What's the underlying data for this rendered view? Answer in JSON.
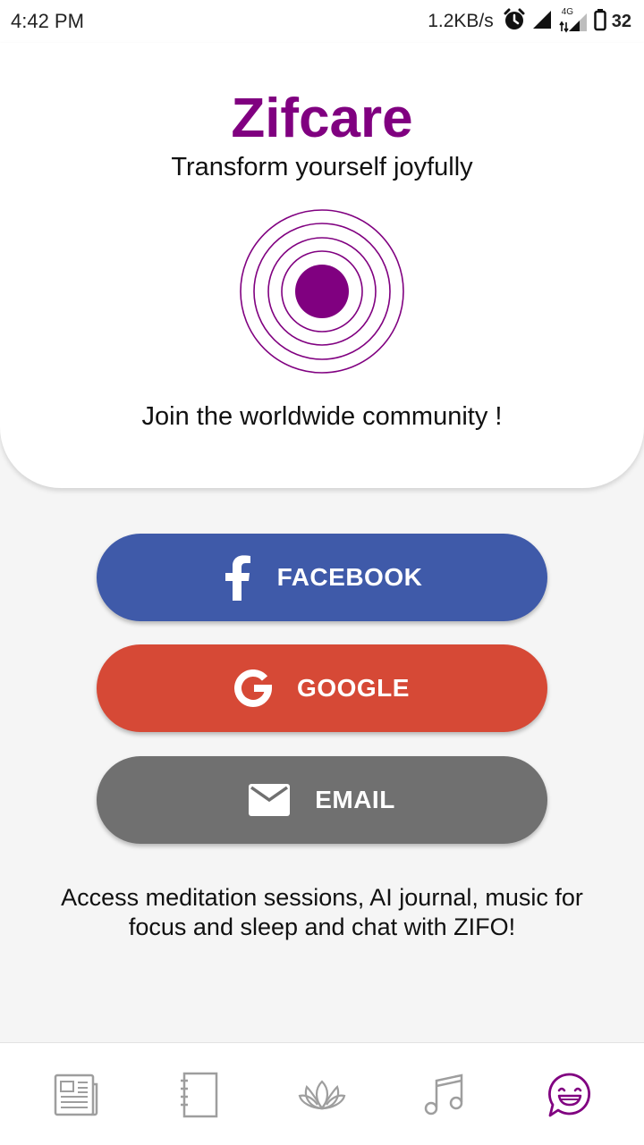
{
  "status_bar": {
    "time": "4:42 PM",
    "speed": "1.2KB/s",
    "network": "4G",
    "battery": "32",
    "icons": [
      "alarm-icon",
      "signal-icon",
      "signal-4g-icon",
      "battery-icon"
    ]
  },
  "hero": {
    "title": "Zifcare",
    "tagline": "Transform yourself joyfully",
    "join_text": "Join the worldwide community !"
  },
  "buttons": {
    "facebook": {
      "label": "FACEBOOK",
      "icon": "facebook-icon",
      "color": "#3f5aa9"
    },
    "google": {
      "label": "GOOGLE",
      "icon": "google-icon",
      "color": "#d64936"
    },
    "email": {
      "label": "EMAIL",
      "icon": "envelope-icon",
      "color": "#707070"
    }
  },
  "description": "Access meditation sessions, AI journal, music for focus and sleep and chat with ZIFO!",
  "bottom_nav": {
    "items": [
      {
        "icon": "news-icon",
        "active": false
      },
      {
        "icon": "journal-icon",
        "active": false
      },
      {
        "icon": "lotus-icon",
        "active": false
      },
      {
        "icon": "music-icon",
        "active": false
      },
      {
        "icon": "chat-smiley-icon",
        "active": true
      }
    ]
  },
  "colors": {
    "brand": "#800080",
    "inactive_icon": "#9e9e9e"
  }
}
